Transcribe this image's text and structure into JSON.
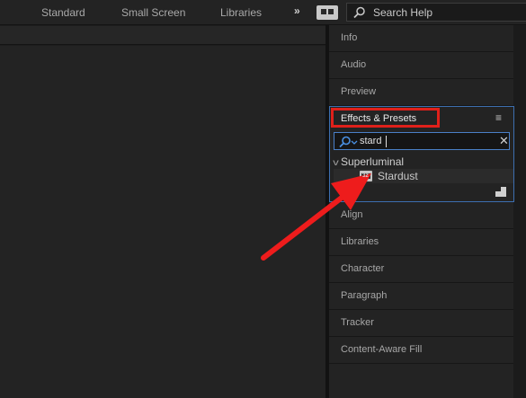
{
  "workspaces": {
    "tabs": [
      {
        "label": "Standard"
      },
      {
        "label": "Small Screen"
      },
      {
        "label": "Libraries"
      }
    ],
    "more_label": "»",
    "search_placeholder": "Search Help"
  },
  "right_panels": {
    "top": [
      {
        "label": "Info"
      },
      {
        "label": "Audio"
      },
      {
        "label": "Preview"
      }
    ],
    "bottom": [
      {
        "label": "Align"
      },
      {
        "label": "Libraries"
      },
      {
        "label": "Character"
      },
      {
        "label": "Paragraph"
      },
      {
        "label": "Tracker"
      },
      {
        "label": "Content-Aware Fill"
      }
    ]
  },
  "effects_presets": {
    "title": "Effects & Presets",
    "menu_glyph": "≡",
    "search_value": "stard",
    "clear_glyph": "✕",
    "tree": {
      "folder": {
        "chevron": "v",
        "label": "Superluminal"
      },
      "item": {
        "badge": "32",
        "label": "Stardust"
      }
    }
  },
  "annotation": {
    "highlight_color": "#e0201a",
    "arrow_color": "#ee1c1c"
  },
  "colors": {
    "background": "#1d1d1d",
    "panel": "#232323",
    "selection_border": "#3d6fb0"
  }
}
